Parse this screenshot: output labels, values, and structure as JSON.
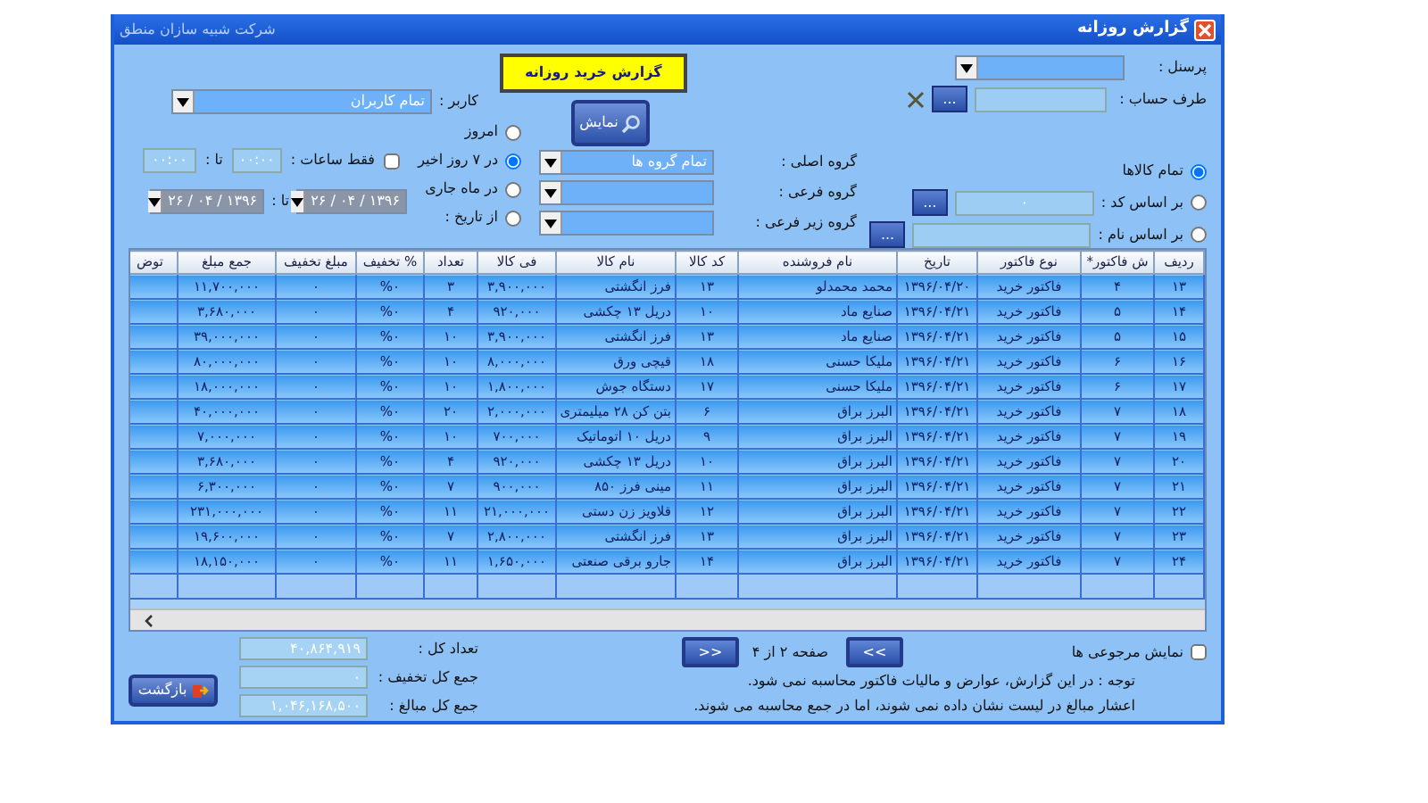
{
  "window": {
    "title": "گزارش روزانه",
    "company": "شرکت شبیه سازان منطق"
  },
  "report_title": "گزارش خرید روزانه",
  "show_button": "نمایش",
  "personnel": {
    "label": "پرسنل :"
  },
  "account": {
    "label": "طرف حساب :",
    "browse": "..."
  },
  "user": {
    "label": "کاربر :",
    "value": "تمام کاربران"
  },
  "item_filters": [
    {
      "label": "تمام کالاها",
      "selected": true,
      "kind": "plain"
    },
    {
      "label": "بر اساس کد :",
      "selected": false,
      "kind": "code",
      "value": "۰",
      "browse": "..."
    },
    {
      "label": "بر اساس نام :",
      "selected": false,
      "kind": "name",
      "browse": "..."
    }
  ],
  "groups": [
    {
      "label": "گروه اصلی :",
      "value": "تمام گروه ها"
    },
    {
      "label": "گروه فرعی :"
    },
    {
      "label": "گروه زیر فرعی :"
    }
  ],
  "date_filters": [
    {
      "label": "امروز",
      "selected": false
    },
    {
      "label": "در ۷ روز اخیر",
      "selected": true
    },
    {
      "label": "در ماه جاری",
      "selected": false
    },
    {
      "label": "از تاریخ :",
      "selected": false
    }
  ],
  "hours": {
    "label": "فقط ساعات :",
    "checked": false,
    "from": "۰۰:۰۰",
    "to_label": "تا :",
    "to": "۰۰:۰۰"
  },
  "dates": {
    "from": "۱۳۹۶ / ۰۴ / ۲۶",
    "to_label": "تا :",
    "to": "۱۳۹۶ / ۰۴ / ۲۶"
  },
  "table": {
    "columns": [
      "ردیف",
      "ش فاکتور*",
      "نوع فاکتور",
      "تاریخ",
      "نام فروشنده",
      "کد کالا",
      "نام کالا",
      "فی کالا",
      "تعداد",
      "% تخفیف",
      "مبلغ تخفیف",
      "جمع مبلغ",
      "توض"
    ],
    "rows": [
      [
        "۱۳",
        "۴",
        "فاکتور خرید",
        "۱۳۹۶/۰۴/۲۰",
        "محمد محمدلو",
        "۱۳",
        "فرز انگشتی",
        "۳,۹۰۰,۰۰۰",
        "۳",
        "%۰",
        "۰",
        "۱۱,۷۰۰,۰۰۰"
      ],
      [
        "۱۴",
        "۵",
        "فاکتور خرید",
        "۱۳۹۶/۰۴/۲۱",
        "صنایع ماد",
        "۱۰",
        "دریل ۱۳ چکشی",
        "۹۲۰,۰۰۰",
        "۴",
        "%۰",
        "۰",
        "۳,۶۸۰,۰۰۰"
      ],
      [
        "۱۵",
        "۵",
        "فاکتور خرید",
        "۱۳۹۶/۰۴/۲۱",
        "صنایع ماد",
        "۱۳",
        "فرز انگشتی",
        "۳,۹۰۰,۰۰۰",
        "۱۰",
        "%۰",
        "۰",
        "۳۹,۰۰۰,۰۰۰"
      ],
      [
        "۱۶",
        "۶",
        "فاکتور خرید",
        "۱۳۹۶/۰۴/۲۱",
        "ملیکا حسنی",
        "۱۸",
        "قیچی ورق",
        "۸,۰۰۰,۰۰۰",
        "۱۰",
        "%۰",
        "۰",
        "۸۰,۰۰۰,۰۰۰"
      ],
      [
        "۱۷",
        "۶",
        "فاکتور خرید",
        "۱۳۹۶/۰۴/۲۱",
        "ملیکا حسنی",
        "۱۷",
        "دستگاه جوش",
        "۱,۸۰۰,۰۰۰",
        "۱۰",
        "%۰",
        "۰",
        "۱۸,۰۰۰,۰۰۰"
      ],
      [
        "۱۸",
        "۷",
        "فاکتور خرید",
        "۱۳۹۶/۰۴/۲۱",
        "البرز براق",
        "۶",
        "بتن کن ۲۸ میلیمتری",
        "۲,۰۰۰,۰۰۰",
        "۲۰",
        "%۰",
        "۰",
        "۴۰,۰۰۰,۰۰۰"
      ],
      [
        "۱۹",
        "۷",
        "فاکتور خرید",
        "۱۳۹۶/۰۴/۲۱",
        "البرز براق",
        "۹",
        "دریل ۱۰ اتوماتیک",
        "۷۰۰,۰۰۰",
        "۱۰",
        "%۰",
        "۰",
        "۷,۰۰۰,۰۰۰"
      ],
      [
        "۲۰",
        "۷",
        "فاکتور خرید",
        "۱۳۹۶/۰۴/۲۱",
        "البرز براق",
        "۱۰",
        "دریل ۱۳ چکشی",
        "۹۲۰,۰۰۰",
        "۴",
        "%۰",
        "۰",
        "۳,۶۸۰,۰۰۰"
      ],
      [
        "۲۱",
        "۷",
        "فاکتور خرید",
        "۱۳۹۶/۰۴/۲۱",
        "البرز براق",
        "۱۱",
        "مینی فرز ۸۵۰",
        "۹۰۰,۰۰۰",
        "۷",
        "%۰",
        "۰",
        "۶,۳۰۰,۰۰۰"
      ],
      [
        "۲۲",
        "۷",
        "فاکتور خرید",
        "۱۳۹۶/۰۴/۲۱",
        "البرز براق",
        "۱۲",
        "قلاویز زن دستی",
        "۲۱,۰۰۰,۰۰۰",
        "۱۱",
        "%۰",
        "۰",
        "۲۳۱,۰۰۰,۰۰۰"
      ],
      [
        "۲۳",
        "۷",
        "فاکتور خرید",
        "۱۳۹۶/۰۴/۲۱",
        "البرز براق",
        "۱۳",
        "فرز انگشتی",
        "۲,۸۰۰,۰۰۰",
        "۷",
        "%۰",
        "۰",
        "۱۹,۶۰۰,۰۰۰"
      ],
      [
        "۲۴",
        "۷",
        "فاکتور خرید",
        "۱۳۹۶/۰۴/۲۱",
        "البرز براق",
        "۱۴",
        "جارو برقی صنعتی",
        "۱,۶۵۰,۰۰۰",
        "۱۱",
        "%۰",
        "۰",
        "۱۸,۱۵۰,۰۰۰"
      ]
    ]
  },
  "returns_checkbox": {
    "label": "نمایش مرجوعی ها",
    "checked": false
  },
  "pager": {
    "next": ">>",
    "text": "صفحه ۲ از ۴",
    "prev": "<<"
  },
  "notes": [
    "توجه : در این گزارش، عوارض و مالیات فاکتور محاسبه نمی شود.",
    "اعشار مبالغ در لیست نشان داده نمی شوند، اما در جمع محاسبه می شوند."
  ],
  "totals": [
    {
      "label": "تعداد کل :",
      "value": "۴۰,۸۶۴,۹۱۹"
    },
    {
      "label": "جمع کل تخفیف :",
      "value": "۰"
    },
    {
      "label": "جمع کل مبالغ :",
      "value": "۱,۰۴۶,۱۶۸,۵۰۰"
    }
  ],
  "back_button": "بازگشت"
}
